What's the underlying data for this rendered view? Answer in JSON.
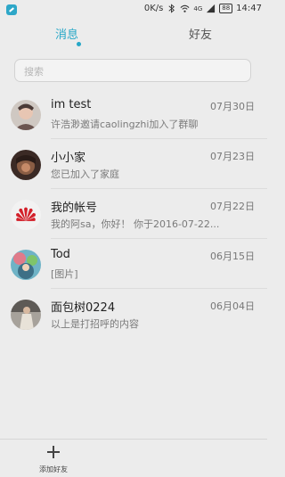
{
  "status_bar": {
    "speed": "0K/s",
    "network": "4G",
    "battery": "88",
    "time": "14:47"
  },
  "tabs": [
    {
      "label": "消息",
      "active": true
    },
    {
      "label": "好友",
      "active": false
    }
  ],
  "search": {
    "placeholder": "搜索"
  },
  "conversations": [
    {
      "name": "im test",
      "date": "07月30日",
      "message": "许浩渺邀请caolingzhi加入了群聊"
    },
    {
      "name": "小小家",
      "date": "07月23日",
      "message": "您已加入了家庭"
    },
    {
      "name": "我的帐号",
      "date": "07月22日",
      "message": "我的阿sa，你好！ 你于2016-07-22..."
    },
    {
      "name": "Tod",
      "date": "06月15日",
      "message": "[图片]"
    },
    {
      "name": "面包树0224",
      "date": "06月04日",
      "message": "以上是打招呼的内容"
    }
  ],
  "bottom_bar": {
    "add_friend_label": "添加好友"
  },
  "colors": {
    "accent": "#26a7c7",
    "background": "#ececec"
  }
}
